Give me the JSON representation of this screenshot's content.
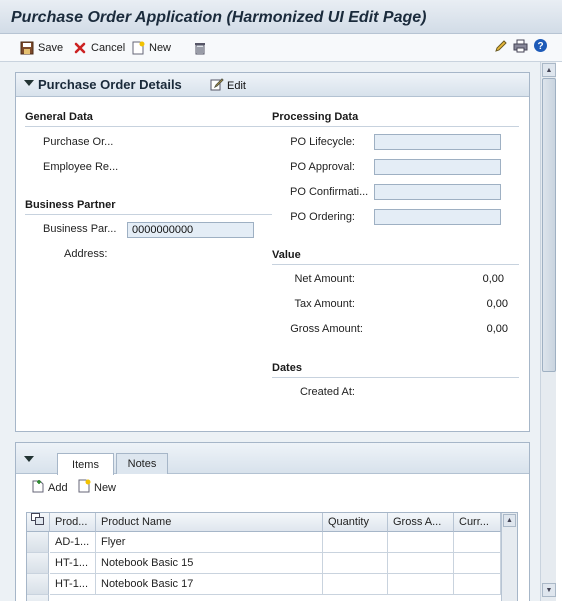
{
  "app": {
    "title": "Purchase Order Application (Harmonized UI Edit Page)"
  },
  "toolbar": {
    "save_label": "Save",
    "cancel_label": "Cancel",
    "new_label": "New"
  },
  "details": {
    "title": "Purchase Order Details",
    "edit_label": "Edit",
    "general": {
      "title": "General Data",
      "purchase_order_label": "Purchase Or...",
      "employee_label": "Employee Re..."
    },
    "business_partner": {
      "title": "Business Partner",
      "bp_label": "Business Par...",
      "bp_value": "0000000000",
      "address_label": "Address:"
    },
    "processing": {
      "title": "Processing Data",
      "lifecycle_label": "PO Lifecycle:",
      "lifecycle_value": "",
      "approval_label": "PO Approval:",
      "approval_value": "",
      "confirmation_label": "PO Confirmati...",
      "confirmation_value": "",
      "ordering_label": "PO Ordering:",
      "ordering_value": ""
    },
    "value": {
      "title": "Value",
      "net_label": "Net Amount:",
      "net_value": "0,00",
      "tax_label": "Tax Amount:",
      "tax_value": "0,00",
      "gross_label": "Gross Amount:",
      "gross_value": "0,00"
    },
    "dates": {
      "title": "Dates",
      "created_label": "Created At:"
    }
  },
  "items_section": {
    "tabs": [
      "Items",
      "Notes"
    ],
    "active_tab": "Items",
    "add_label": "Add",
    "new_label": "New",
    "columns": [
      "Prod...",
      "Product Name",
      "Quantity",
      "Gross A...",
      "Curr..."
    ],
    "rows": [
      [
        "AD-1...",
        "Flyer",
        "",
        "",
        ""
      ],
      [
        "HT-1...",
        "Notebook Basic 15",
        "",
        "",
        ""
      ],
      [
        "HT-1...",
        "Notebook Basic 17",
        "",
        "",
        ""
      ]
    ]
  }
}
